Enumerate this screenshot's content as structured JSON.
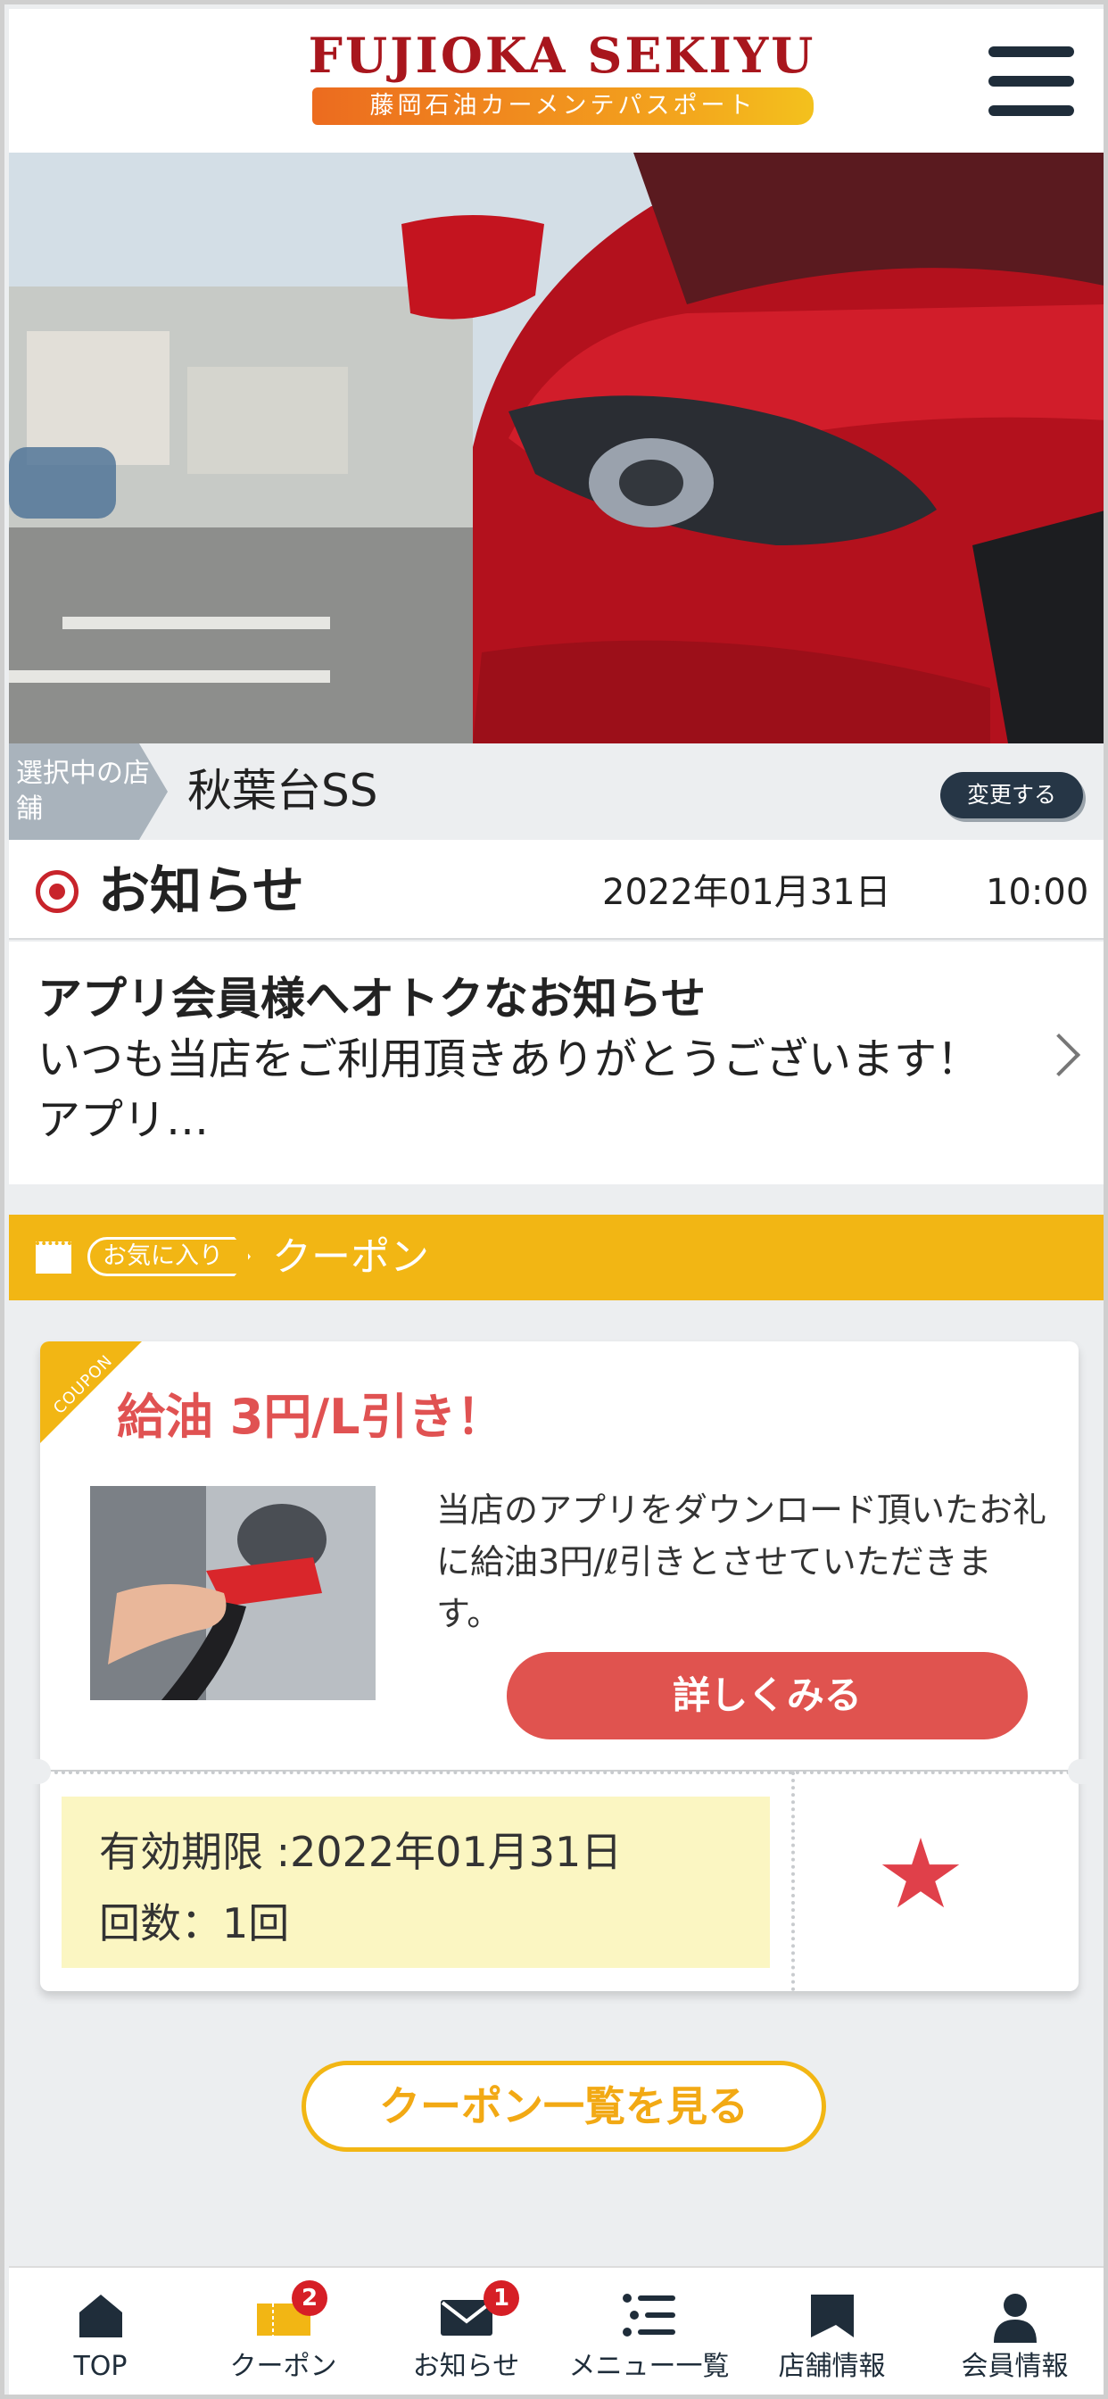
{
  "header": {
    "brand": "FUJIOKA SEKIYU",
    "subtitle": "藤岡石油カーメンテパスポート"
  },
  "store": {
    "tag": "選択中の店舗",
    "name": "秋葉台SS",
    "change_label": "変更する"
  },
  "news": {
    "heading": "お知らせ",
    "date": "2022年01月31日",
    "time": "10:00",
    "item_title": "アプリ会員様へオトクなお知らせ",
    "item_text": "いつも当店をご利用頂きありがとうございます！アプリ…"
  },
  "favorites": {
    "tag": "お気に入り",
    "title": "クーポン"
  },
  "coupon": {
    "ribbon": "COUPON",
    "title": "給油 3円/L引き！",
    "description": "当店のアプリをダウンロード頂いたお礼に給油3円/ℓ引きとさせていただきます。",
    "detail_button": "詳しくみる",
    "expiry": "有効期限 :2022年01月31日",
    "count": "回数：1回"
  },
  "coupon_list_button": "クーポン一覧を見る",
  "tabbar": {
    "items": [
      {
        "label": "TOP",
        "icon": "home-icon"
      },
      {
        "label": "クーポン",
        "icon": "coupon-icon",
        "badge": "2"
      },
      {
        "label": "お知らせ",
        "icon": "mail-icon",
        "badge": "1"
      },
      {
        "label": "メニュー一覧",
        "icon": "list-icon"
      },
      {
        "label": "店舗情報",
        "icon": "store-icon"
      },
      {
        "label": "会員情報",
        "icon": "user-icon"
      }
    ]
  },
  "colors": {
    "brand_red": "#a8161d",
    "accent_yellow": "#f2b614",
    "coupon_red": "#e0534f",
    "navy": "#1f2d3a"
  }
}
